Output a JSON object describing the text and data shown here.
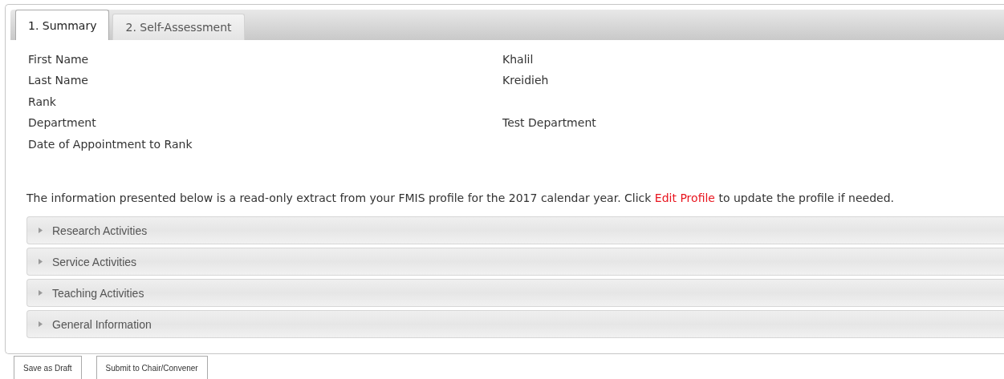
{
  "tabs": [
    {
      "label": "1. Summary",
      "selected": true
    },
    {
      "label": "2. Self-Assessment",
      "selected": false
    }
  ],
  "fields": [
    {
      "label": "First Name",
      "value": "Khalil"
    },
    {
      "label": "Last Name",
      "value": "Kreidieh"
    },
    {
      "label": "Rank"
    },
    {
      "label": "Department",
      "value": "Test Department"
    },
    {
      "label": "Date of Appointment to Rank"
    }
  ],
  "intro": {
    "text_before": "The information presented below is a read-only extract from your FMIS profile for the 2017 calendar year. Click ",
    "link": "Edit Profile",
    "text_after": " to update the profile if needed."
  },
  "sections": [
    {
      "title": "Research Activities",
      "expanded": false
    },
    {
      "title": "Service Activities",
      "expanded": false
    },
    {
      "title": "Teaching Activities",
      "expanded": false
    },
    {
      "title": "General Information",
      "expanded": false
    }
  ],
  "buttons": [
    "Save as Draft",
    "Submit to Chair/Convener"
  ]
}
